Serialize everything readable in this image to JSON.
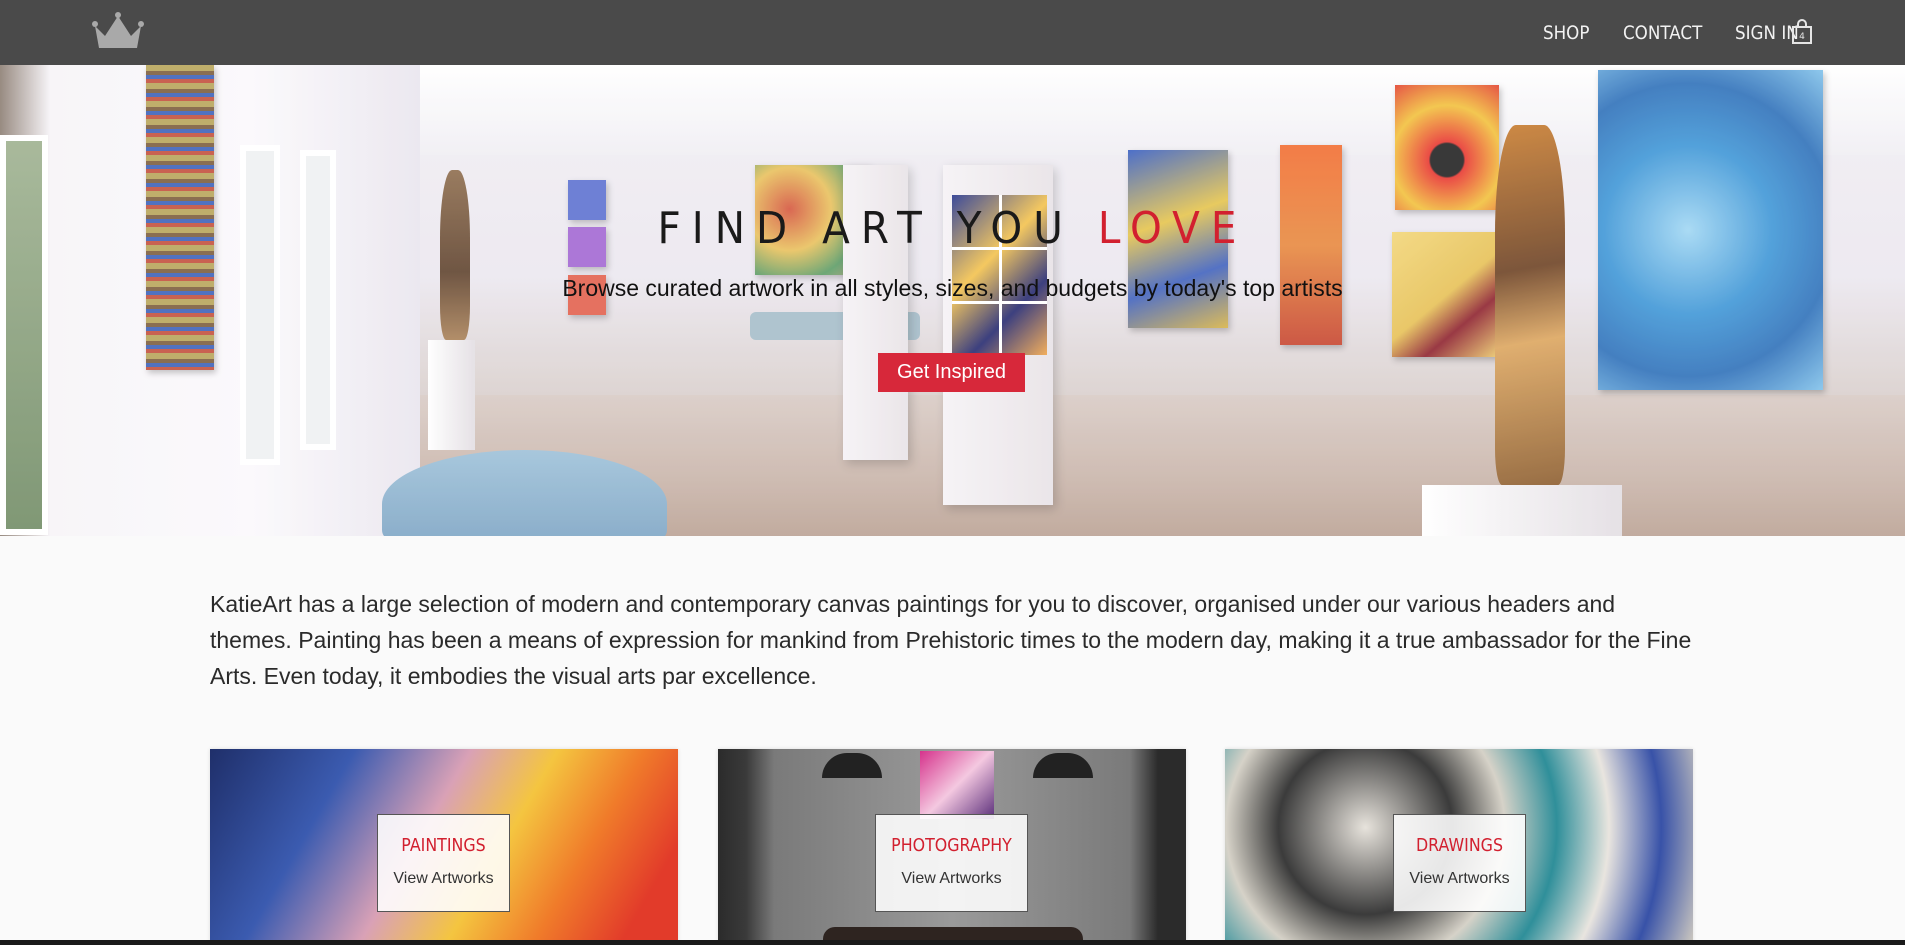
{
  "nav": {
    "logo_icon": "crown-icon",
    "links": [
      "SHOP",
      "CONTACT",
      "SIGN IN"
    ],
    "cart_icon": "shopping-bag-icon",
    "cart_count": "4"
  },
  "hero": {
    "title_main": "FIND ART YOU ",
    "title_accent": "LOVE",
    "subtitle": "Browse curated artwork in all styles, sizes, and budgets by today's top artists",
    "button_label": "Get Inspired",
    "accent_color": "#d2202f",
    "button_color": "#d7283a"
  },
  "intro": {
    "text": "KatieArt has a large selection of modern and contemporary canvas paintings for you to discover, organised under our various headers and themes. Painting has been a means of expression for mankind from Prehistoric times to the modern day, making it a true ambassador for the Fine Arts. Even today, it embodies the visual arts par excellence."
  },
  "categories": [
    {
      "title": "PAINTINGS",
      "link": "View Artworks"
    },
    {
      "title": "PHOTOGRAPHY",
      "link": "View Artworks"
    },
    {
      "title": "DRAWINGS",
      "link": "View Artworks"
    }
  ],
  "colors": {
    "navbar": "#4a4a4a",
    "page_background": "#fafafa"
  }
}
